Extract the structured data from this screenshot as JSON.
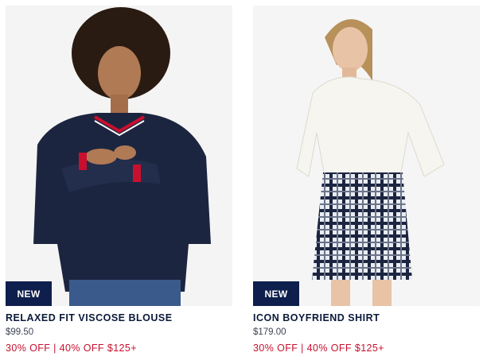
{
  "products": [
    {
      "badge": "NEW",
      "name": "RELAXED FIT VISCOSE BLOUSE",
      "price": "$99.50",
      "promo": "30% OFF | 40% OFF $125+"
    },
    {
      "badge": "NEW",
      "name": "ICON BOYFRIEND SHIRT",
      "price": "$179.00",
      "promo": "30% OFF | 40% OFF $125+"
    }
  ],
  "colors": {
    "badge_bg": "#0e1f4d",
    "title": "#0b1a3a",
    "promo": "#c8102e"
  }
}
